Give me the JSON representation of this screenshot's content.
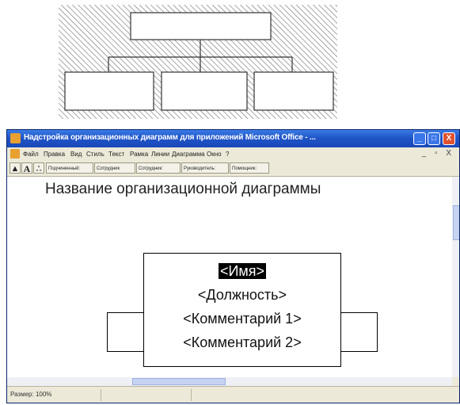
{
  "window": {
    "title": "Надстройка организационных диаграмм для приложений Microsoft Office - ...",
    "buttons": {
      "minimize": "_",
      "maximize": "□",
      "close": "X"
    }
  },
  "menu": {
    "items": [
      "Файл",
      "Правка",
      "Вид",
      "Стиль",
      "Текст",
      "Рамка",
      "Линии",
      "Диаграмма",
      "Окно",
      "?"
    ],
    "right_controls": "_ ▫ X"
  },
  "toolbar": {
    "items": [
      "Подчиненный:",
      "Сотрудник",
      "Сотрудник:",
      "Руководитель:",
      "Помощник:"
    ]
  },
  "chart": {
    "title": "Название организационной диаграммы",
    "main_box": {
      "name": "<Имя>",
      "position": "<Должность>",
      "comment1": "<Комментарий 1>",
      "comment2": "<Комментарий 2>"
    }
  },
  "status": {
    "zoom": "Размер: 100%"
  }
}
